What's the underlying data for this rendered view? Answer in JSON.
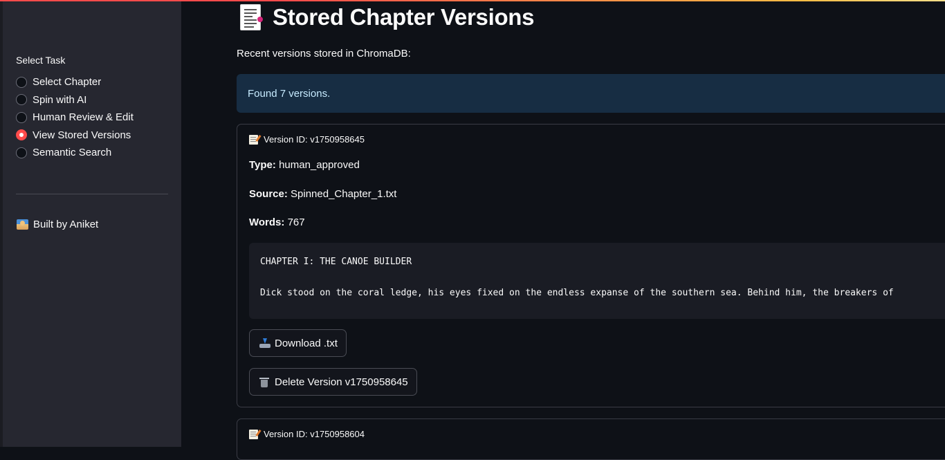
{
  "sidebar": {
    "task_label": "Select Task",
    "options": [
      {
        "label": "Select Chapter",
        "checked": false
      },
      {
        "label": "Spin with AI",
        "checked": false
      },
      {
        "label": "Human Review & Edit",
        "checked": false
      },
      {
        "label": "View Stored Versions",
        "checked": true
      },
      {
        "label": "Semantic Search",
        "checked": false
      }
    ],
    "built_by": "Built by Aniket",
    "built_by_icon": "technologist-icon"
  },
  "main": {
    "title": "Stored Chapter Versions",
    "title_icon": "page-facing-up-icon",
    "subtitle": "Recent versions stored in ChromaDB:",
    "info": "Found 7 versions.",
    "versions": [
      {
        "version_id_label": "Version ID: v1750958645",
        "type_label": "Type:",
        "type_value": "human_approved",
        "source_label": "Source:",
        "source_value": "Spinned_Chapter_1.txt",
        "words_label": "Words:",
        "words_value": "767",
        "preview_line1": "CHAPTER I: THE CANOE BUILDER",
        "preview_line2": "Dick stood on the coral ledge, his eyes fixed on the endless expanse of the southern sea. Behind him, the breakers of",
        "download_label": "Download .txt",
        "delete_label": "Delete Version v1750958645"
      },
      {
        "version_id_label": "Version ID: v1750958604"
      }
    ]
  },
  "colors": {
    "accent": "#ff4b4b",
    "info_bg": "#172d43",
    "info_text": "#c7ebff",
    "sidebar_bg": "#262730",
    "main_bg": "#0e1117"
  }
}
